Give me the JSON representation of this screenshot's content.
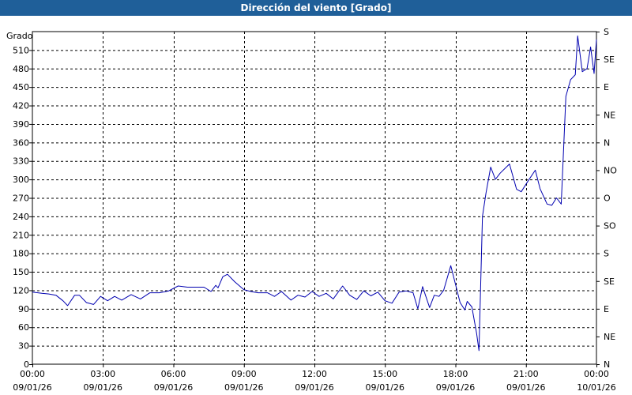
{
  "window": {
    "title": "Dirección del viento [Grado]"
  },
  "colors": {
    "title_bar": "#1f5f99",
    "series": "#0000b0",
    "grid": "#000000"
  },
  "chart_data": {
    "type": "line",
    "title": "Dirección del viento [Grado]",
    "ylabel": "Grado",
    "ylim": [
      0,
      540
    ],
    "xlim": [
      0,
      24
    ],
    "yticks": [
      0,
      30,
      60,
      90,
      120,
      150,
      180,
      210,
      240,
      270,
      300,
      330,
      360,
      390,
      420,
      450,
      480,
      510
    ],
    "right_ticks": [
      {
        "value": 0,
        "label": "N"
      },
      {
        "value": 45,
        "label": "NE"
      },
      {
        "value": 90,
        "label": "E"
      },
      {
        "value": 135,
        "label": "SE"
      },
      {
        "value": 180,
        "label": "S"
      },
      {
        "value": 225,
        "label": "SO"
      },
      {
        "value": 270,
        "label": "O"
      },
      {
        "value": 315,
        "label": "NO"
      },
      {
        "value": 360,
        "label": "N"
      },
      {
        "value": 405,
        "label": "NE"
      },
      {
        "value": 450,
        "label": "E"
      },
      {
        "value": 495,
        "label": "SE"
      },
      {
        "value": 540,
        "label": "S"
      }
    ],
    "xticks": [
      {
        "value": 0,
        "time": "00:00",
        "date": "09/01/26"
      },
      {
        "value": 3,
        "time": "03:00",
        "date": "09/01/26"
      },
      {
        "value": 6,
        "time": "06:00",
        "date": "09/01/26"
      },
      {
        "value": 9,
        "time": "09:00",
        "date": "09/01/26"
      },
      {
        "value": 12,
        "time": "12:00",
        "date": "09/01/26"
      },
      {
        "value": 15,
        "time": "15:00",
        "date": "09/01/26"
      },
      {
        "value": 18,
        "time": "18:00",
        "date": "09/01/26"
      },
      {
        "value": 21,
        "time": "21:00",
        "date": "09/01/26"
      },
      {
        "value": 24,
        "time": "00:00",
        "date": "10/01/26"
      }
    ],
    "grid": true,
    "series": [
      {
        "x": [
          0,
          0.4,
          0.7,
          1.0,
          1.3,
          1.5,
          1.8,
          2.0,
          2.3,
          2.6,
          2.9,
          3.2,
          3.5,
          3.8,
          4.2,
          4.6,
          5.0,
          5.4,
          5.8,
          6.2,
          6.6,
          7.0,
          7.3,
          7.6,
          7.8,
          7.9,
          8.1,
          8.3,
          8.6,
          9.0,
          9.3,
          9.6,
          10.0,
          10.3,
          10.6,
          11.0,
          11.3,
          11.6,
          11.9,
          12.2,
          12.5,
          12.8,
          13.2,
          13.5,
          13.8,
          14.1,
          14.4,
          14.7,
          15.0,
          15.3,
          15.6,
          15.9,
          16.2,
          16.4,
          16.6,
          16.9,
          17.1,
          17.3,
          17.5,
          17.8,
          18.0,
          18.2,
          18.4,
          18.5,
          18.7,
          18.9,
          19.0,
          19.15,
          19.3,
          19.5,
          19.7,
          19.9,
          20.3,
          20.6,
          20.8,
          21.1,
          21.4,
          21.6,
          21.9,
          22.1,
          22.3,
          22.5,
          22.7,
          22.9,
          23.1,
          23.2,
          23.4,
          23.6,
          23.75,
          23.9,
          24.0
        ],
        "y": [
          117,
          115,
          114,
          112,
          103,
          95,
          112,
          112,
          100,
          97,
          110,
          103,
          110,
          104,
          113,
          106,
          116,
          116,
          119,
          127,
          125,
          125,
          125,
          118,
          128,
          124,
          142,
          146,
          134,
          121,
          118,
          116,
          116,
          110,
          118,
          104,
          112,
          109,
          118,
          110,
          115,
          106,
          127,
          112,
          105,
          119,
          111,
          117,
          103,
          99,
          117,
          119,
          116,
          90,
          126,
          92,
          112,
          110,
          120,
          160,
          130,
          100,
          88,
          102,
          93,
          50,
          22,
          240,
          278,
          320,
          300,
          310,
          325,
          284,
          280,
          298,
          315,
          285,
          260,
          258,
          270,
          260,
          435,
          462,
          470,
          533,
          475,
          480,
          515,
          472,
          527
        ]
      }
    ]
  }
}
